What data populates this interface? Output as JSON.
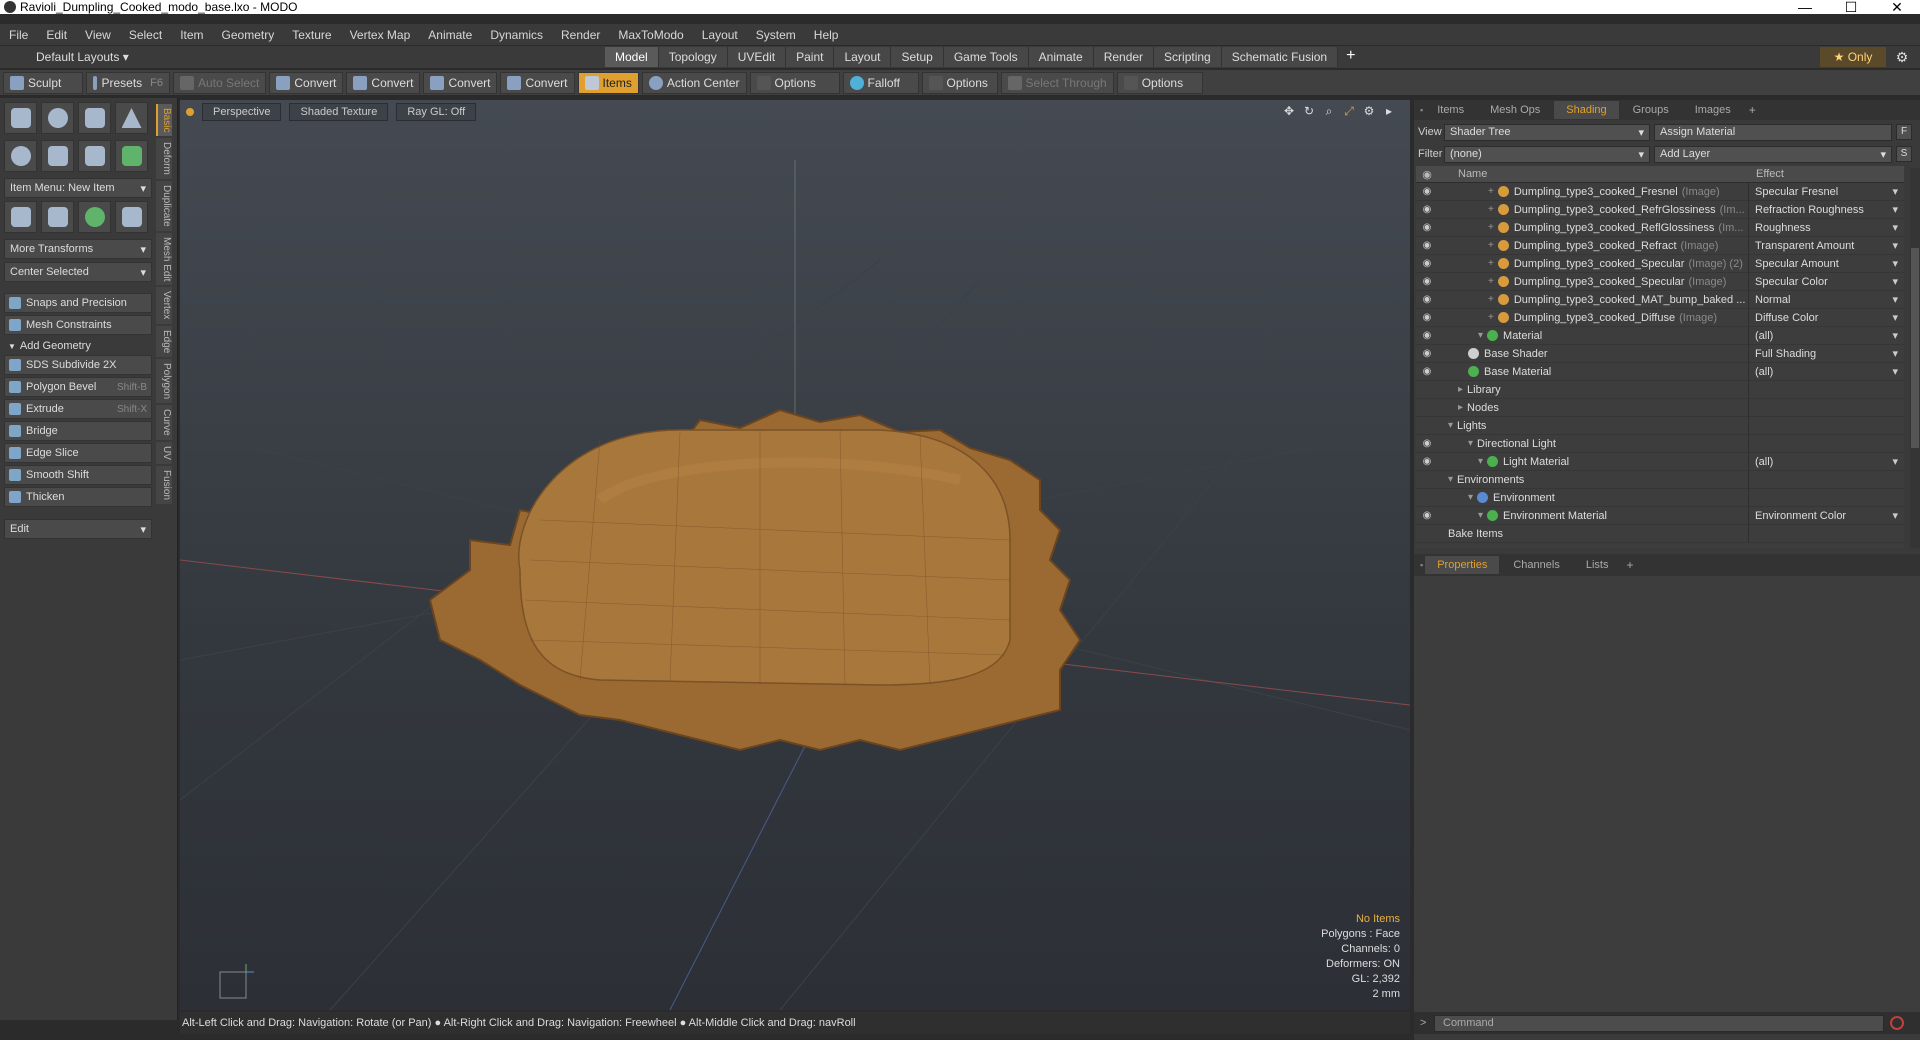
{
  "window": {
    "title": "Ravioli_Dumpling_Cooked_modo_base.lxo - MODO",
    "controls": [
      "—",
      "☐",
      "✕"
    ]
  },
  "menu": [
    "File",
    "Edit",
    "View",
    "Select",
    "Item",
    "Geometry",
    "Texture",
    "Vertex Map",
    "Animate",
    "Dynamics",
    "Render",
    "MaxToModo",
    "Layout",
    "System",
    "Help"
  ],
  "layout_selector": "Default Layouts ▾",
  "mode_tabs": [
    "Model",
    "Topology",
    "UVEdit",
    "Paint",
    "Layout",
    "Setup",
    "Game Tools",
    "Animate",
    "Render",
    "Scripting",
    "Schematic Fusion"
  ],
  "active_mode_tab": "Model",
  "only_label": "★  Only",
  "toolbar": {
    "sculpt": "Sculpt",
    "presets": "Presets",
    "presets_key": "F6",
    "auto_select": "Auto Select",
    "convert1": "Convert",
    "convert2": "Convert",
    "convert3": "Convert",
    "convert4": "Convert",
    "items": "Items",
    "action_center": "Action Center",
    "options1": "Options",
    "falloff": "Falloff",
    "options2": "Options",
    "select_through": "Select Through",
    "options3": "Options"
  },
  "left": {
    "item_menu": "Item Menu: New Item",
    "more_transforms": "More Transforms",
    "center_selected": "Center Selected",
    "snaps": "Snaps and Precision",
    "mesh_constraints": "Mesh Constraints",
    "add_geometry": "Add Geometry",
    "tools": [
      {
        "label": "SDS Subdivide 2X",
        "key": ""
      },
      {
        "label": "Polygon Bevel",
        "key": "Shift-B"
      },
      {
        "label": "Extrude",
        "key": "Shift-X"
      },
      {
        "label": "Bridge",
        "key": ""
      },
      {
        "label": "Edge Slice",
        "key": ""
      },
      {
        "label": "Smooth Shift",
        "key": ""
      },
      {
        "label": "Thicken",
        "key": ""
      }
    ],
    "edit": "Edit",
    "vtabs": [
      "Basic",
      "Deform",
      "Duplicate",
      "Mesh Edit",
      "Vertex",
      "Edge",
      "Polygon",
      "Curve",
      "UV",
      "Fusion"
    ]
  },
  "viewport": {
    "perspective": "Perspective",
    "shading": "Shaded Texture",
    "raygl": "Ray GL: Off",
    "stats": {
      "items": "No Items",
      "polygons": "Polygons : Face",
      "channels": "Channels: 0",
      "deformers": "Deformers: ON",
      "gl": "GL: 2,392",
      "scale": "2 mm"
    }
  },
  "status": "Alt-Left Click and Drag: Navigation: Rotate (or Pan) ● Alt-Right Click and Drag: Navigation: Freewheel ● Alt-Middle Click and Drag: navRoll",
  "right": {
    "tabs": [
      "Items",
      "Mesh Ops",
      "Shading",
      "Groups",
      "Images"
    ],
    "active_tab": "Shading",
    "view_label": "View",
    "view_value": "Shader Tree",
    "assign_material": "Assign Material",
    "filter_label": "Filter",
    "filter_value": "(none)",
    "add_layer": "Add Layer",
    "col_name": "Name",
    "col_effect": "Effect",
    "rows": [
      {
        "name": "Dumpling_type3_cooked_Fresnel",
        "tag": "(Image)",
        "effect": "Specular Fresnel",
        "indent": 5,
        "eye": true,
        "ball": "#d89a3a"
      },
      {
        "name": "Dumpling_type3_cooked_RefrGlossiness",
        "tag": "(Im...",
        "effect": "Refraction Roughness",
        "indent": 5,
        "eye": true,
        "ball": "#d89a3a"
      },
      {
        "name": "Dumpling_type3_cooked_ReflGlossiness",
        "tag": "(Im...",
        "effect": "Roughness",
        "indent": 5,
        "eye": true,
        "ball": "#d89a3a"
      },
      {
        "name": "Dumpling_type3_cooked_Refract",
        "tag": "(Image)",
        "effect": "Transparent Amount",
        "indent": 5,
        "eye": true,
        "ball": "#d89a3a"
      },
      {
        "name": "Dumpling_type3_cooked_Specular",
        "tag": "(Image) (2)",
        "effect": "Specular Amount",
        "indent": 5,
        "eye": true,
        "ball": "#d89a3a"
      },
      {
        "name": "Dumpling_type3_cooked_Specular",
        "tag": "(Image)",
        "effect": "Specular Color",
        "indent": 5,
        "eye": true,
        "ball": "#d89a3a"
      },
      {
        "name": "Dumpling_type3_cooked_MAT_bump_baked ...",
        "tag": "",
        "effect": "Normal",
        "indent": 5,
        "eye": true,
        "ball": "#d89a3a"
      },
      {
        "name": "Dumpling_type3_cooked_Diffuse",
        "tag": "(Image)",
        "effect": "Diffuse Color",
        "indent": 5,
        "eye": true,
        "ball": "#d89a3a"
      },
      {
        "name": "Material",
        "tag": "",
        "effect": "(all)",
        "indent": 4,
        "eye": true,
        "ball": "#4caf50"
      },
      {
        "name": "Base Shader",
        "tag": "",
        "effect": "Full Shading",
        "indent": 3,
        "eye": true,
        "ball": "#cfcfcf"
      },
      {
        "name": "Base Material",
        "tag": "",
        "effect": "(all)",
        "indent": 3,
        "eye": true,
        "ball": "#4caf50"
      },
      {
        "name": "Library",
        "tag": "",
        "effect": "",
        "indent": 2,
        "eye": false,
        "ball": ""
      },
      {
        "name": "Nodes",
        "tag": "",
        "effect": "",
        "indent": 2,
        "eye": false,
        "ball": ""
      },
      {
        "name": "Lights",
        "tag": "",
        "effect": "",
        "indent": 1,
        "eye": false,
        "ball": ""
      },
      {
        "name": "Directional Light",
        "tag": "",
        "effect": "",
        "indent": 3,
        "eye": true,
        "ball": ""
      },
      {
        "name": "Light Material",
        "tag": "",
        "effect": "(all)",
        "indent": 4,
        "eye": true,
        "ball": "#4caf50"
      },
      {
        "name": "Environments",
        "tag": "",
        "effect": "",
        "indent": 1,
        "eye": false,
        "ball": ""
      },
      {
        "name": "Environment",
        "tag": "",
        "effect": "",
        "indent": 3,
        "eye": false,
        "ball": "#5a8ad0"
      },
      {
        "name": "Environment Material",
        "tag": "",
        "effect": "Environment Color",
        "indent": 4,
        "eye": true,
        "ball": "#4caf50"
      },
      {
        "name": "Bake Items",
        "tag": "",
        "effect": "",
        "indent": 1,
        "eye": false,
        "ball": ""
      }
    ],
    "props_tabs": [
      "Properties",
      "Channels",
      "Lists"
    ],
    "active_props_tab": "Properties",
    "command_placeholder": "Command"
  }
}
